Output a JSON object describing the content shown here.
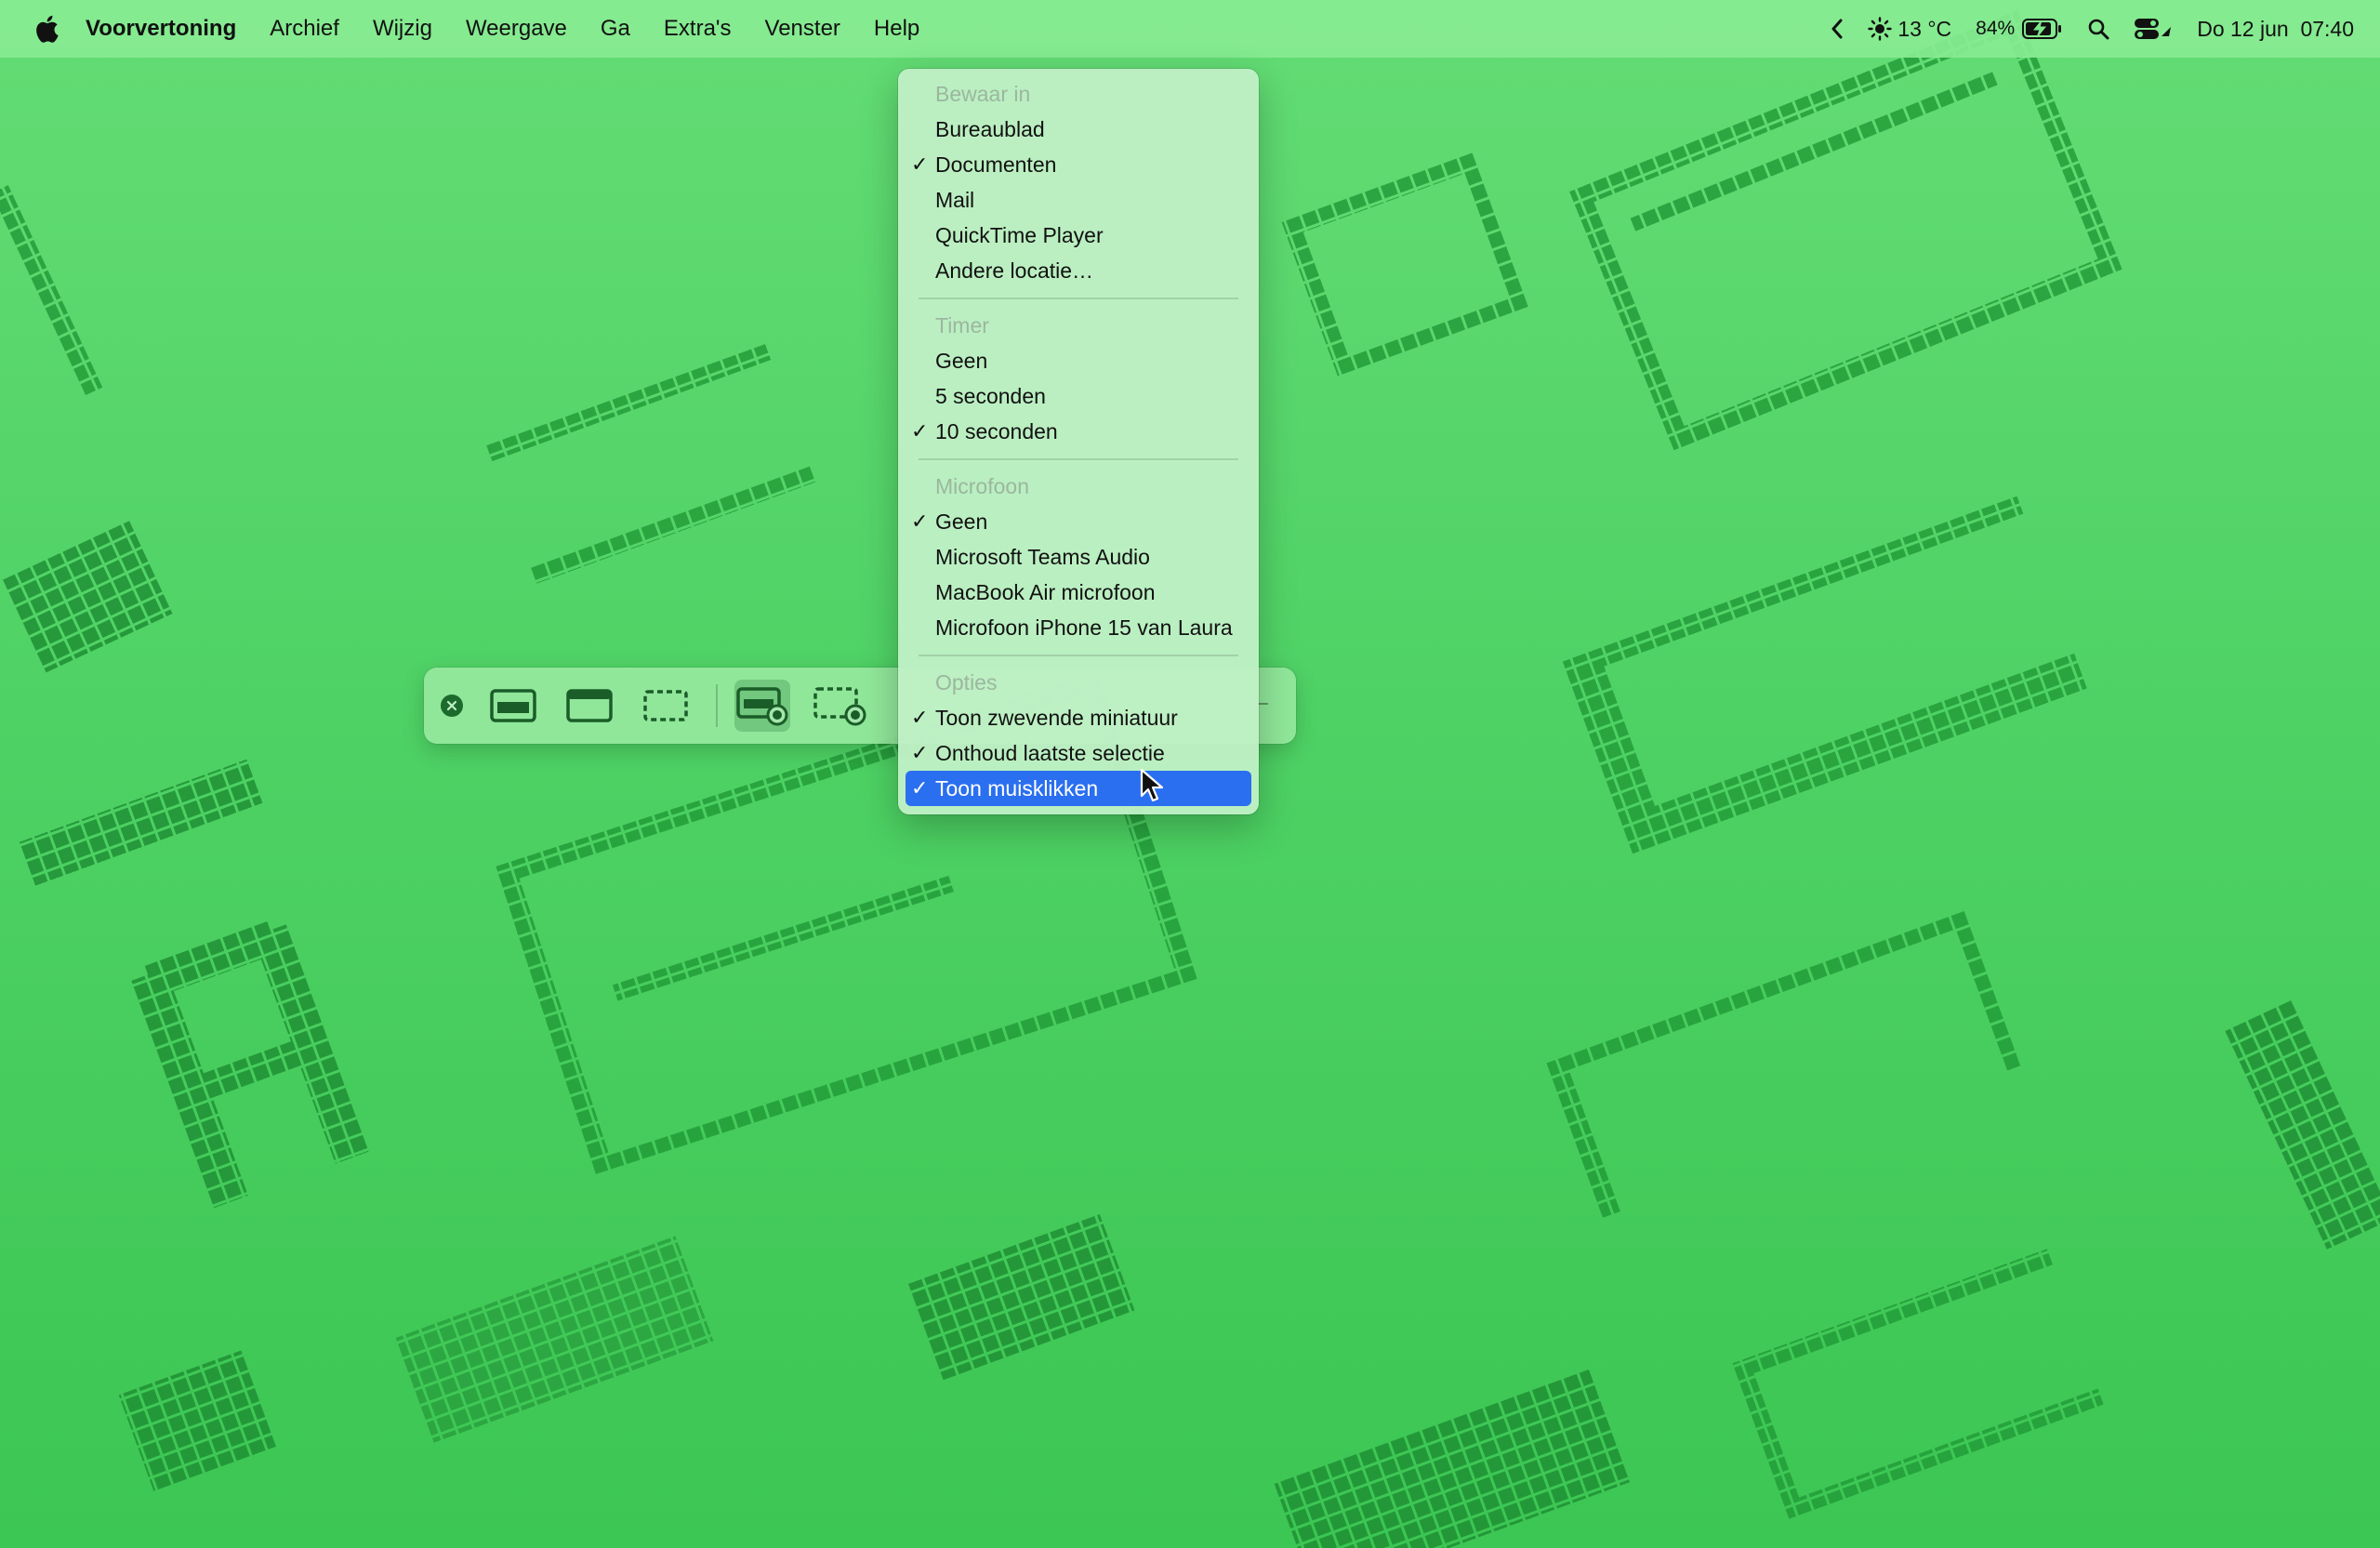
{
  "menubar": {
    "app_name": "Voorvertoning",
    "menus": [
      "Archief",
      "Wijzig",
      "Weergave",
      "Ga",
      "Extra's",
      "Venster",
      "Help"
    ],
    "weather": "13 °C",
    "battery": "84%",
    "datetime": "Do 12 jun  07:40"
  },
  "dropdown": {
    "save_header": "Bewaar in",
    "save_items": [
      {
        "label": "Bureaublad",
        "checked": ""
      },
      {
        "label": "Documenten",
        "checked": "✓"
      },
      {
        "label": "Mail",
        "checked": ""
      },
      {
        "label": "QuickTime Player",
        "checked": ""
      },
      {
        "label": "Andere locatie…",
        "checked": ""
      }
    ],
    "timer_header": "Timer",
    "timer_items": [
      {
        "label": "Geen",
        "checked": ""
      },
      {
        "label": "5 seconden",
        "checked": ""
      },
      {
        "label": "10 seconden",
        "checked": "✓"
      }
    ],
    "mic_header": "Microfoon",
    "mic_items": [
      {
        "label": "Geen",
        "checked": "✓"
      },
      {
        "label": "Microsoft Teams Audio",
        "checked": ""
      },
      {
        "label": "MacBook Air microfoon",
        "checked": ""
      },
      {
        "label": "Microfoon iPhone 15 van Laura",
        "checked": ""
      }
    ],
    "options_header": "Opties",
    "options_items": [
      {
        "label": "Toon zwevende miniatuur",
        "checked": "✓"
      },
      {
        "label": "Onthoud laatste selectie",
        "checked": "✓"
      },
      {
        "label": "Toon muisklikken",
        "checked": "✓"
      }
    ]
  },
  "colors": {
    "accent": "#2a6ff0",
    "pixel_art": "#249a3a"
  }
}
